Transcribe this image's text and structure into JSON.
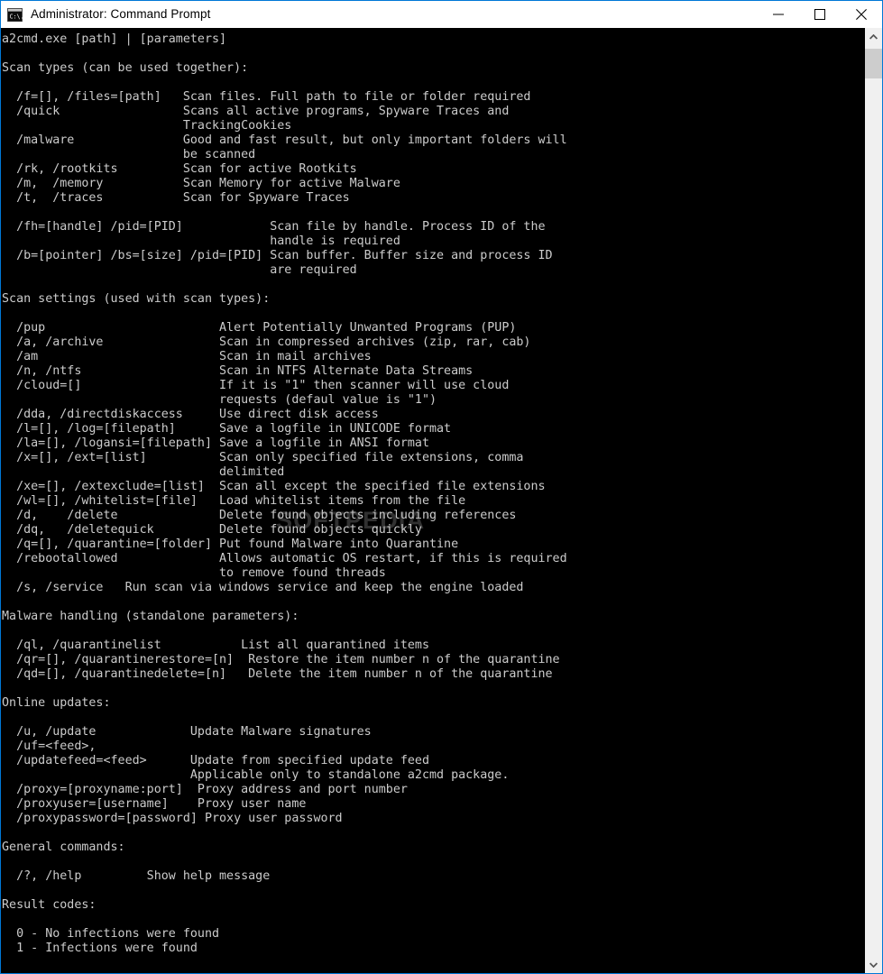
{
  "window": {
    "title": "Administrator: Command Prompt",
    "icon": "command-prompt-icon",
    "border_color": "#0078d7",
    "titlebar_bg": "#ffffff",
    "console_bg": "#000000",
    "console_fg": "#cccccc"
  },
  "titlebar_buttons": {
    "minimize": "minimize-icon",
    "maximize": "maximize-icon",
    "close": "close-icon"
  },
  "scrollbar": {
    "up_arrow": "chevron-up-icon",
    "down_arrow": "chevron-down-icon",
    "thumb_position": "top"
  },
  "watermark": {
    "text": "SOFTPEDIA",
    "registered_mark": "®",
    "color": "#bebebe"
  },
  "console": {
    "usage": "a2cmd.exe [path] | [parameters]",
    "sections": [
      {
        "heading": "Scan types (can be used together):",
        "entries": [
          {
            "option": "/f=[], /files=[path]",
            "description": [
              "Scan files. Full path to file or folder required"
            ]
          },
          {
            "option": "/quick",
            "description": [
              "Scans all active programs, Spyware Traces and",
              "TrackingCookies"
            ]
          },
          {
            "option": "/malware",
            "description": [
              "Good and fast result, but only important folders will",
              "be scanned"
            ]
          },
          {
            "option": "/rk, /rootkits",
            "description": [
              "Scan for active Rootkits"
            ]
          },
          {
            "option": "/m,  /memory",
            "description": [
              "Scan Memory for active Malware"
            ]
          },
          {
            "option": "/t,  /traces",
            "description": [
              "Scan for Spyware Traces"
            ]
          },
          {
            "option": "",
            "description": []
          },
          {
            "option": "/fh=[handle] /pid=[PID]",
            "description": [
              "Scan file by handle. Process ID of the",
              "handle is required"
            ]
          },
          {
            "option": "/b=[pointer] /bs=[size] /pid=[PID]",
            "description": [
              "Scan buffer. Buffer size and process ID",
              "are required"
            ]
          }
        ]
      },
      {
        "heading": "Scan settings (used with scan types):",
        "entries": [
          {
            "option": "/pup",
            "description": [
              "Alert Potentially Unwanted Programs (PUP)"
            ]
          },
          {
            "option": "/a, /archive",
            "description": [
              "Scan in compressed archives (zip, rar, cab)"
            ]
          },
          {
            "option": "/am",
            "description": [
              "Scan in mail archives"
            ]
          },
          {
            "option": "/n, /ntfs",
            "description": [
              "Scan in NTFS Alternate Data Streams"
            ]
          },
          {
            "option": "/cloud=[]",
            "description": [
              "If it is \"1\" then scanner will use cloud",
              "requests (defaul value is \"1\")"
            ]
          },
          {
            "option": "/dda, /directdiskaccess",
            "description": [
              "Use direct disk access"
            ]
          },
          {
            "option": "/l=[], /log=[filepath]",
            "description": [
              "Save a logfile in UNICODE format"
            ]
          },
          {
            "option": "/la=[], /logansi=[filepath]",
            "description": [
              "Save a logfile in ANSI format"
            ]
          },
          {
            "option": "/x=[], /ext=[list]",
            "description": [
              "Scan only specified file extensions, comma",
              "delimited"
            ]
          },
          {
            "option": "/xe=[], /extexclude=[list]",
            "description": [
              "Scan all except the specified file extensions"
            ]
          },
          {
            "option": "/wl=[], /whitelist=[file]",
            "description": [
              "Load whitelist items from the file"
            ]
          },
          {
            "option": "/d,    /delete",
            "description": [
              "Delete found objects including references"
            ]
          },
          {
            "option": "/dq,   /deletequick",
            "description": [
              "Delete found objects quickly"
            ]
          },
          {
            "option": "/q=[], /quarantine=[folder]",
            "description": [
              "Put found Malware into Quarantine"
            ]
          },
          {
            "option": "/rebootallowed",
            "description": [
              "Allows automatic OS restart, if this is required",
              "to remove found threads"
            ]
          },
          {
            "option": "/s, /service",
            "description": [
              "Run scan via windows service and keep the engine loaded"
            ]
          }
        ]
      },
      {
        "heading": "Malware handling (standalone parameters):",
        "entries": [
          {
            "option": "/ql, /quarantinelist",
            "description": [
              "List all quarantined items"
            ]
          },
          {
            "option": "/qr=[], /quarantinerestore=[n]",
            "description": [
              "Restore the item number n of the quarantine"
            ]
          },
          {
            "option": "/qd=[], /quarantinedelete=[n]",
            "description": [
              "Delete the item number n of the quarantine"
            ]
          }
        ]
      },
      {
        "heading": "Online updates:",
        "entries": [
          {
            "option": "/u, /update",
            "description": [
              "Update Malware signatures"
            ]
          },
          {
            "option": "/uf=<feed>,",
            "description": []
          },
          {
            "option": "/updatefeed=<feed>",
            "description": [
              "Update from specified update feed",
              "Applicable only to standalone a2cmd package."
            ]
          },
          {
            "option": "/proxy=[proxyname:port]",
            "description": [
              "Proxy address and port number"
            ]
          },
          {
            "option": "/proxyuser=[username]",
            "description": [
              "Proxy user name"
            ]
          },
          {
            "option": "/proxypassword=[password]",
            "description": [
              "Proxy user password"
            ]
          }
        ]
      },
      {
        "heading": "General commands:",
        "entries": [
          {
            "option": "/?, /help",
            "description": [
              "Show help message"
            ]
          }
        ]
      },
      {
        "heading": "Result codes:",
        "entries": [
          {
            "option": "0 - No infections were found",
            "description": []
          },
          {
            "option": "1 - Infections were found",
            "description": []
          }
        ]
      }
    ],
    "raw_text": "a2cmd.exe [path] | [parameters]\n\nScan types (can be used together):\n\n  /f=[], /files=[path]   Scan files. Full path to file or folder required\n  /quick                 Scans all active programs, Spyware Traces and\n                         TrackingCookies\n  /malware               Good and fast result, but only important folders will\n                         be scanned\n  /rk, /rootkits         Scan for active Rootkits\n  /m,  /memory           Scan Memory for active Malware\n  /t,  /traces           Scan for Spyware Traces\n\n  /fh=[handle] /pid=[PID]            Scan file by handle. Process ID of the\n                                     handle is required\n  /b=[pointer] /bs=[size] /pid=[PID] Scan buffer. Buffer size and process ID\n                                     are required\n\nScan settings (used with scan types):\n\n  /pup                        Alert Potentially Unwanted Programs (PUP)\n  /a, /archive                Scan in compressed archives (zip, rar, cab)\n  /am                         Scan in mail archives\n  /n, /ntfs                   Scan in NTFS Alternate Data Streams\n  /cloud=[]                   If it is \"1\" then scanner will use cloud\n                              requests (defaul value is \"1\")\n  /dda, /directdiskaccess     Use direct disk access\n  /l=[], /log=[filepath]      Save a logfile in UNICODE format\n  /la=[], /logansi=[filepath] Save a logfile in ANSI format\n  /x=[], /ext=[list]          Scan only specified file extensions, comma\n                              delimited\n  /xe=[], /extexclude=[list]  Scan all except the specified file extensions\n  /wl=[], /whitelist=[file]   Load whitelist items from the file\n  /d,    /delete              Delete found objects including references\n  /dq,   /deletequick         Delete found objects quickly\n  /q=[], /quarantine=[folder] Put found Malware into Quarantine\n  /rebootallowed              Allows automatic OS restart, if this is required\n                              to remove found threads\n  /s, /service   Run scan via windows service and keep the engine loaded\n\nMalware handling (standalone parameters):\n\n  /ql, /quarantinelist           List all quarantined items\n  /qr=[], /quarantinerestore=[n]  Restore the item number n of the quarantine\n  /qd=[], /quarantinedelete=[n]   Delete the item number n of the quarantine\n\nOnline updates:\n\n  /u, /update             Update Malware signatures\n  /uf=<feed>,\n  /updatefeed=<feed>      Update from specified update feed\n                          Applicable only to standalone a2cmd package.\n  /proxy=[proxyname:port]  Proxy address and port number\n  /proxyuser=[username]    Proxy user name\n  /proxypassword=[password] Proxy user password\n\nGeneral commands:\n\n  /?, /help         Show help message\n\nResult codes:\n\n  0 - No infections were found\n  1 - Infections were found"
  }
}
